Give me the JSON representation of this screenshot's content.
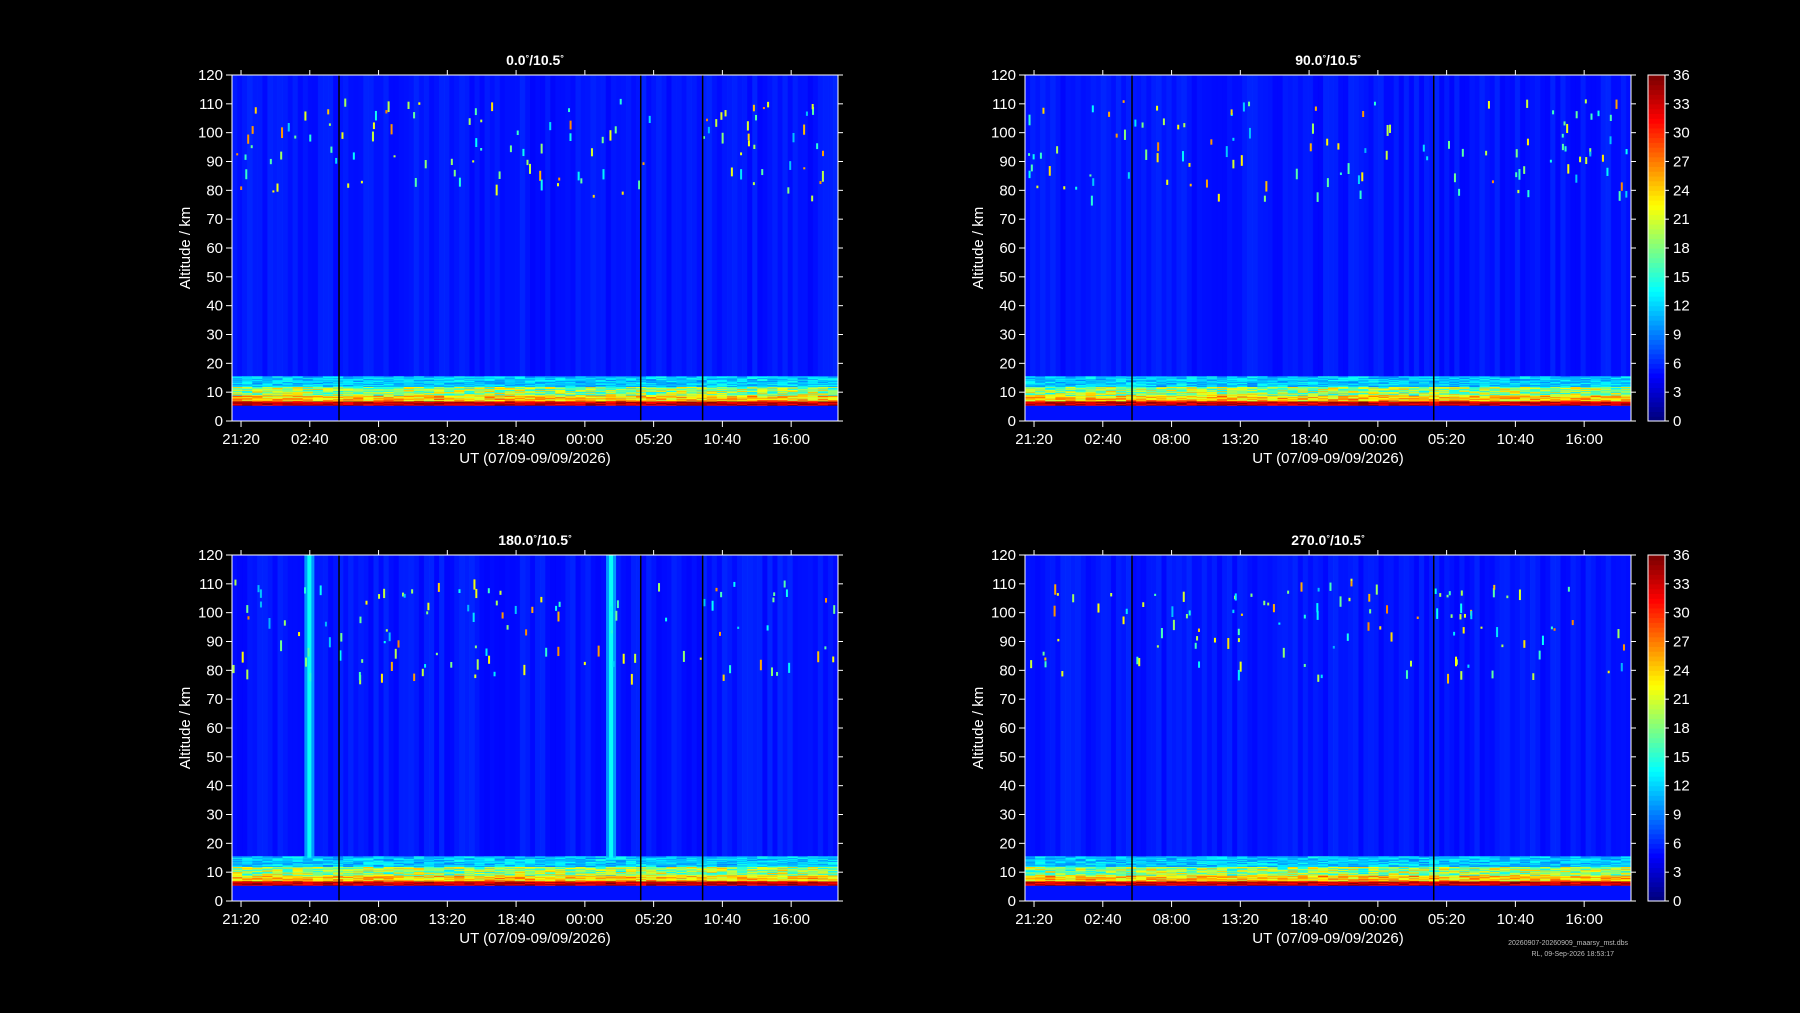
{
  "footer": {
    "line1": "20260907-20260909_maarsy_mst.dbs",
    "line2": "RL, 09-Sep-2026 18:53:17"
  },
  "colorbar": {
    "ticks": [
      0,
      3,
      6,
      9,
      12,
      15,
      18,
      21,
      24,
      27,
      30,
      33,
      36
    ],
    "range": [
      0,
      36
    ],
    "colormap": "jet"
  },
  "chart_data": [
    {
      "type": "heatmap",
      "title_main": "0.0",
      "title_sup1": "°",
      "title_mid": "/10.5",
      "title_sup2": "°",
      "xlabel": "UT (07/09-09/09/2026)",
      "ylabel": "Altitude / km",
      "ylim": [
        0,
        120
      ],
      "yticks": [
        0,
        10,
        20,
        30,
        40,
        50,
        60,
        70,
        80,
        90,
        100,
        110,
        120
      ],
      "xticks": [
        "21:20",
        "02:40",
        "08:00",
        "13:20",
        "18:40",
        "00:00",
        "05:20",
        "10:40",
        "16:00"
      ],
      "xrange_hours": [
        -0.7,
        46.3
      ],
      "data_gaps_hours": [
        7.6,
        31.0,
        35.8
      ],
      "vertical_streaks_hours": [],
      "colorbar": false
    },
    {
      "type": "heatmap",
      "title_main": "90.0",
      "title_sup1": "°",
      "title_mid": "/10.5",
      "title_sup2": "°",
      "xlabel": "UT (07/09-09/09/2026)",
      "ylabel": "Altitude / km",
      "ylim": [
        0,
        120
      ],
      "yticks": [
        0,
        10,
        20,
        30,
        40,
        50,
        60,
        70,
        80,
        90,
        100,
        110,
        120
      ],
      "xticks": [
        "21:20",
        "02:40",
        "08:00",
        "13:20",
        "18:40",
        "00:00",
        "05:20",
        "10:40",
        "16:00"
      ],
      "xrange_hours": [
        -0.7,
        46.3
      ],
      "data_gaps_hours": [
        7.6,
        31.0
      ],
      "vertical_streaks_hours": [],
      "colorbar": true
    },
    {
      "type": "heatmap",
      "title_main": "180.0",
      "title_sup1": "°",
      "title_mid": "/10.5",
      "title_sup2": "°",
      "xlabel": "UT (07/09-09/09/2026)",
      "ylabel": "Altitude / km",
      "ylim": [
        0,
        120
      ],
      "yticks": [
        0,
        10,
        20,
        30,
        40,
        50,
        60,
        70,
        80,
        90,
        100,
        110,
        120
      ],
      "xticks": [
        "21:20",
        "02:40",
        "08:00",
        "13:20",
        "18:40",
        "00:00",
        "05:20",
        "10:40",
        "16:00"
      ],
      "xrange_hours": [
        -0.7,
        46.3
      ],
      "data_gaps_hours": [
        7.6,
        31.0,
        35.8
      ],
      "vertical_streaks_hours": [
        5.3,
        28.7
      ],
      "colorbar": false
    },
    {
      "type": "heatmap",
      "title_main": "270.0",
      "title_sup1": "°",
      "title_mid": "/10.5",
      "title_sup2": "°",
      "xlabel": "UT (07/09-09/09/2026)",
      "ylabel": "Altitude / km",
      "ylim": [
        0,
        120
      ],
      "yticks": [
        0,
        10,
        20,
        30,
        40,
        50,
        60,
        70,
        80,
        90,
        100,
        110,
        120
      ],
      "xticks": [
        "21:20",
        "02:40",
        "08:00",
        "13:20",
        "18:40",
        "00:00",
        "05:20",
        "10:40",
        "16:00"
      ],
      "xrange_hours": [
        -0.7,
        46.3
      ],
      "data_gaps_hours": [
        7.6,
        31.0
      ],
      "vertical_streaks_hours": [],
      "colorbar": true
    }
  ]
}
